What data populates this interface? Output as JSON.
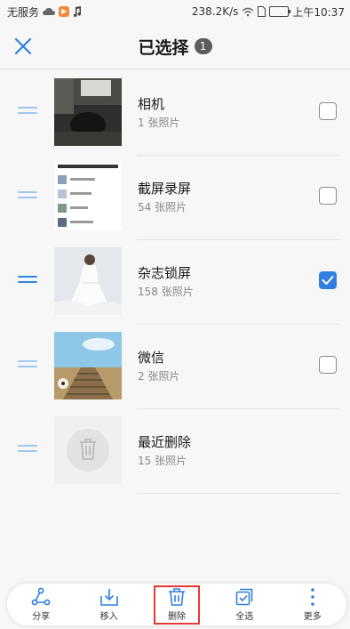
{
  "status_bar": {
    "carrier": "无服务",
    "net_speed": "238.2K/s",
    "time": "上午10:37"
  },
  "header": {
    "title": "已选择",
    "selected_count": "1"
  },
  "albums": [
    {
      "name": "相机",
      "count": "1 张照片",
      "selected": false
    },
    {
      "name": "截屏录屏",
      "count": "54 张照片",
      "selected": false
    },
    {
      "name": "杂志锁屏",
      "count": "158 张照片",
      "selected": true
    },
    {
      "name": "微信",
      "count": "2 张照片",
      "selected": false
    },
    {
      "name": "最近删除",
      "count": "15 张照片",
      "selected": null
    }
  ],
  "toolbar": {
    "share_label": "分享",
    "move_label": "移入",
    "delete_label": "删除",
    "select_all_label": "全选",
    "more_label": "更多"
  },
  "colors": {
    "accent": "#2f7fe0",
    "highlight": "#e53935"
  },
  "icons": {
    "close": "close-icon",
    "share": "share-icon",
    "move": "move-in-icon",
    "delete": "trash-icon",
    "select_all": "select-all-icon",
    "more": "more-icon"
  }
}
